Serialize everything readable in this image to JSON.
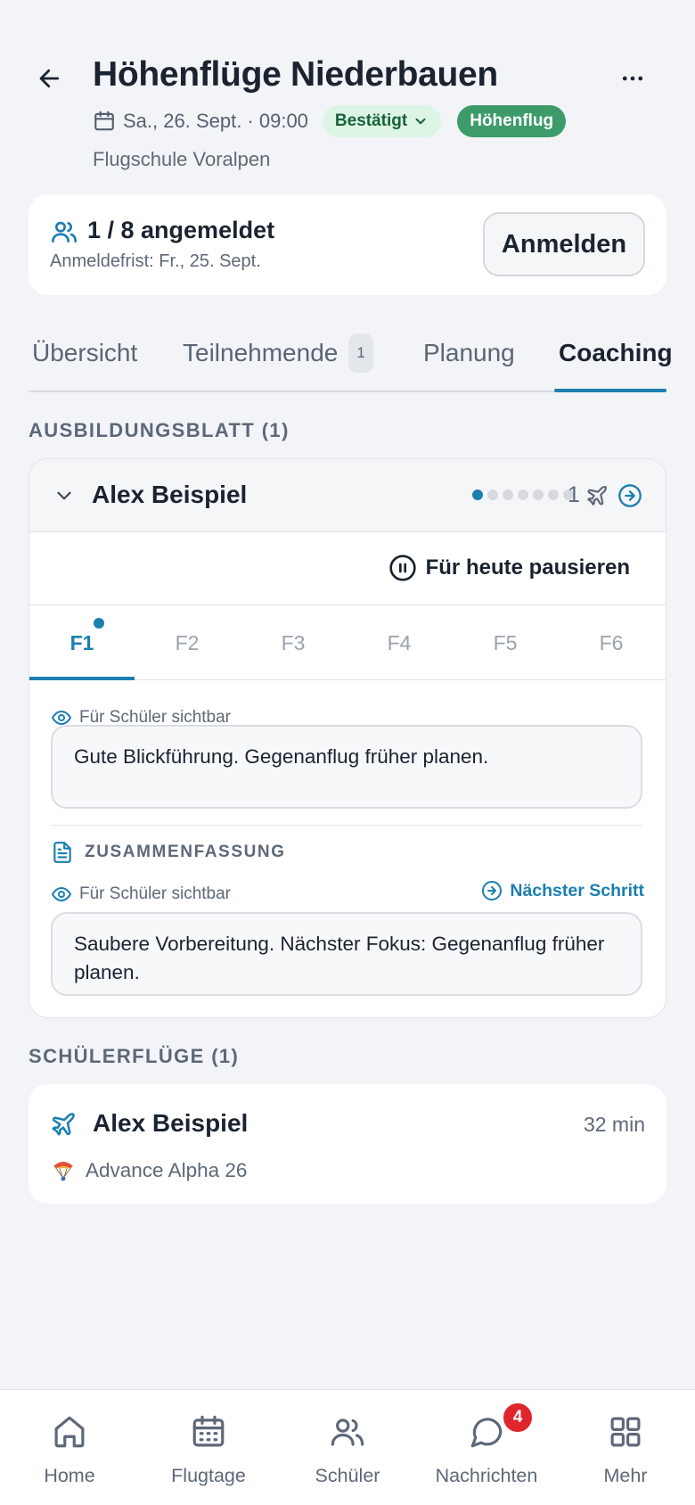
{
  "header": {
    "title": "Höhenflüge Niederbauen",
    "date": "Sa., 26. Sept. · 09:00",
    "status_chip": "Bestätigt",
    "type_chip": "Höhenflug",
    "organizer": "Flugschule Voralpen"
  },
  "registration": {
    "count": "1 / 8 angemeldet",
    "deadline": "Anmeldefrist: Fr., 25. Sept.",
    "button_label": "Anmelden"
  },
  "tabs": [
    {
      "label": "Übersicht"
    },
    {
      "label": "Teilnehmende",
      "badge": "1"
    },
    {
      "label": "Planung"
    },
    {
      "label": "Coaching"
    }
  ],
  "active_tab": "Coaching",
  "training_sheet": {
    "section_label": "AUSBILDUNGSBLATT (1)",
    "student_name": "Alex Beispiel",
    "progress_total_steps": 7,
    "progress_current_step": 1,
    "flight_count": "1",
    "pause_label": "Für heute pausieren",
    "flight_tabs": [
      "F1",
      "F2",
      "F3",
      "F4",
      "F5",
      "F6"
    ],
    "active_flight_tab": "F1",
    "visibility_label": "Für Schüler sichtbar",
    "note_text": "Gute Blickführung. Gegenanflug früher planen.",
    "summary_label": "ZUSAMMENFASSUNG",
    "summary_visibility_label": "Für Schüler sichtbar",
    "next_step_label": "Nächster Schritt",
    "summary_text": "Saubere Vorbereitung. Nächster Fokus: Gegenanflug früher planen."
  },
  "student_flights": {
    "section_label": "SCHÜLERFLÜGE (1)",
    "items": [
      {
        "name": "Alex Beispiel",
        "duration": "32 min",
        "glider": "Advance Alpha 26"
      }
    ]
  },
  "bottom_nav": {
    "items": [
      {
        "label": "Home"
      },
      {
        "label": "Flugtage"
      },
      {
        "label": "Schüler"
      },
      {
        "label": "Nachrichten",
        "badge": "4"
      },
      {
        "label": "Mehr"
      }
    ]
  },
  "colors": {
    "accent": "#1c7fb0",
    "background": "#f2f4f7",
    "confirmed_bg": "#dcf5e4",
    "confirmed_text": "#17633a",
    "type_chip_bg": "#3d9a6a",
    "badge_red": "#e0262d"
  }
}
